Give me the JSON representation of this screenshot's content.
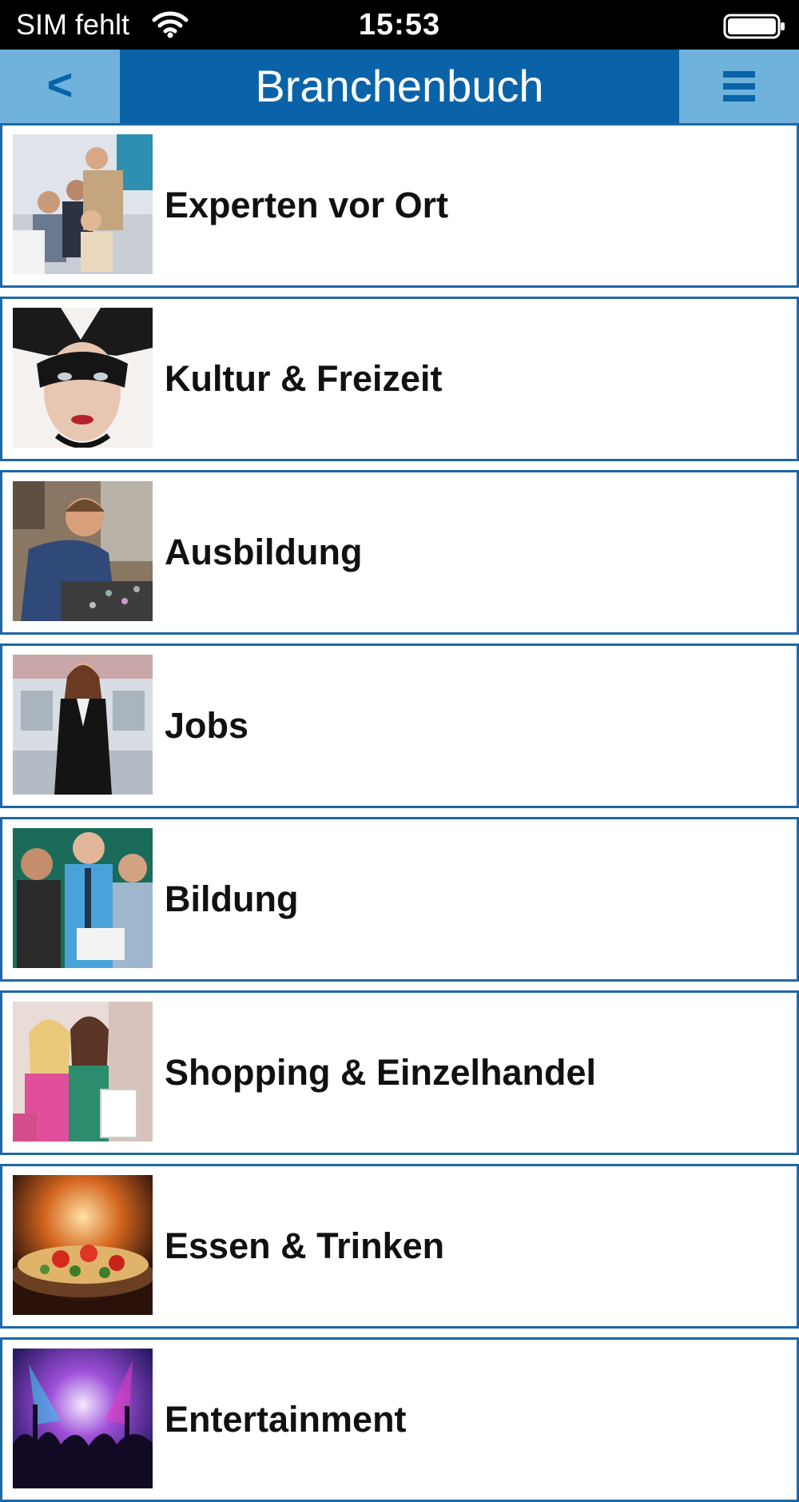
{
  "status_bar": {
    "carrier": "SIM fehlt",
    "time": "15:53",
    "wifi_icon": "wifi-icon",
    "battery_icon": "battery-icon"
  },
  "nav_bar": {
    "back_label": "<",
    "title": "Branchenbuch",
    "menu_icon": "hamburger-menu-icon"
  },
  "colors": {
    "nav_background": "#0a63a8",
    "nav_button_background": "#6fb2dc",
    "item_border": "#1d68a6"
  },
  "categories": [
    {
      "label": "Experten vor Ort",
      "image": "business-team-photo"
    },
    {
      "label": "Kultur & Freizeit",
      "image": "carnival-mask-photo"
    },
    {
      "label": "Ausbildung",
      "image": "apprentice-workshop-photo"
    },
    {
      "label": "Jobs",
      "image": "businesswoman-photo"
    },
    {
      "label": "Bildung",
      "image": "classroom-group-photo"
    },
    {
      "label": "Shopping & Einzelhandel",
      "image": "shopping-women-photo"
    },
    {
      "label": "Essen & Trinken",
      "image": "pizza-food-photo"
    },
    {
      "label": "Entertainment",
      "image": "concert-crowd-photo"
    }
  ]
}
